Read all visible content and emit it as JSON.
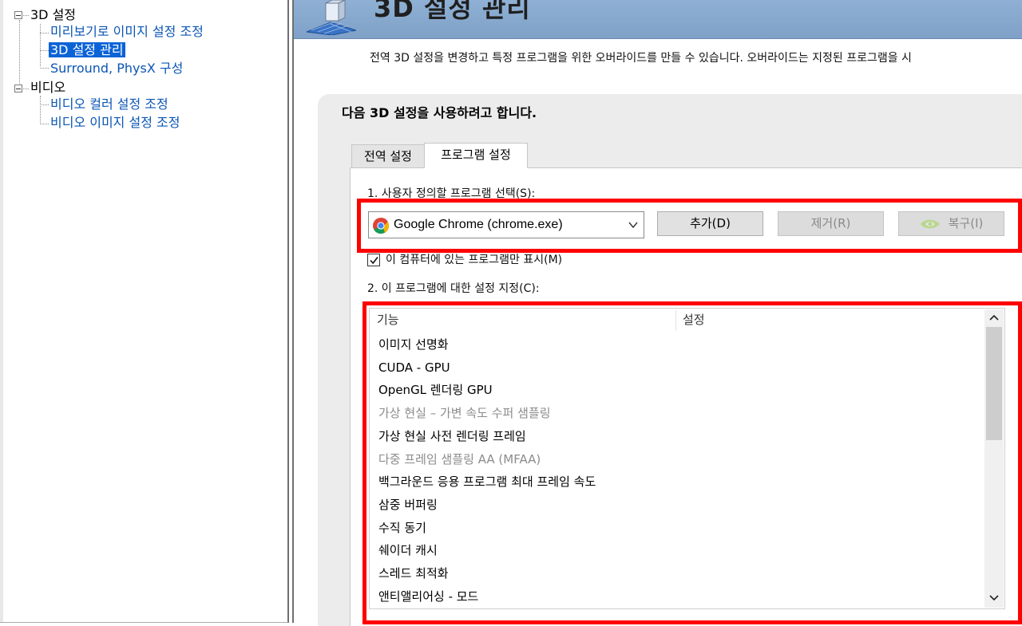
{
  "tree": {
    "groups": [
      {
        "label": "3D 설정",
        "children": [
          "미리보기로 이미지 설정 조정",
          "3D 설정 관리",
          "Surround, PhysX 구성"
        ]
      },
      {
        "label": "비디오",
        "children": [
          "비디오 컬러 설정 조정",
          "비디오 이미지 설정 조정"
        ]
      }
    ],
    "selected": "3D 설정 관리"
  },
  "page": {
    "title": "3D 설정 관리",
    "description": "전역 3D 설정을 변경하고 특정 프로그램을 위한 오버라이드를 만들 수 있습니다. 오버라이드는 지정된 프로그램을 시",
    "heading": "다음 3D 설정을 사용하려고 합니다."
  },
  "tabs": [
    {
      "label": "전역 설정",
      "active": false
    },
    {
      "label": "프로그램 설정",
      "active": true
    }
  ],
  "program_settings": {
    "step1_label": "1. 사용자 정의할 프로그램 선택(S):",
    "selected_program": "Google Chrome (chrome.exe)",
    "add_button": "추가(D)",
    "remove_button": "제거(R)",
    "restore_button": "복구(I)",
    "checkbox_label": "이 컴퓨터에 있는 프로그램만 표시(M)",
    "checkbox_checked": true,
    "step2_label": "2. 이 프로그램에 대한 설정 지정(C):",
    "columns": [
      "기능",
      "설정"
    ],
    "features": [
      {
        "name": "이미지 선명화",
        "dim": false
      },
      {
        "name": "CUDA - GPU",
        "dim": false
      },
      {
        "name": "OpenGL 렌더링 GPU",
        "dim": false
      },
      {
        "name": "가상 현실 – 가변 속도 수퍼 샘플링",
        "dim": true
      },
      {
        "name": "가상 현실 사전 렌더링 프레임",
        "dim": false
      },
      {
        "name": "다중 프레임 샘플링 AA (MFAA)",
        "dim": true
      },
      {
        "name": "백그라운드 응용 프로그램 최대 프레임 속도",
        "dim": false
      },
      {
        "name": "삼중 버퍼링",
        "dim": false
      },
      {
        "name": "수직 동기",
        "dim": false
      },
      {
        "name": "쉐이더 캐시",
        "dim": false
      },
      {
        "name": "스레드 최적화",
        "dim": false
      },
      {
        "name": "앤티앨리어싱 - 모드",
        "dim": false
      }
    ]
  },
  "colors": {
    "highlight": "#ff0000",
    "tree_link": "#0a55b5",
    "tree_selected": "#0b63d6",
    "banner": "#8fb0d4",
    "nvidia_green": "#76b900"
  },
  "icons": {
    "program": "chrome-icon",
    "restore": "nvidia-icon",
    "dropdown": "chevron-down-icon",
    "scroll_up": "chevron-up-icon",
    "scroll_down": "chevron-down-icon"
  }
}
